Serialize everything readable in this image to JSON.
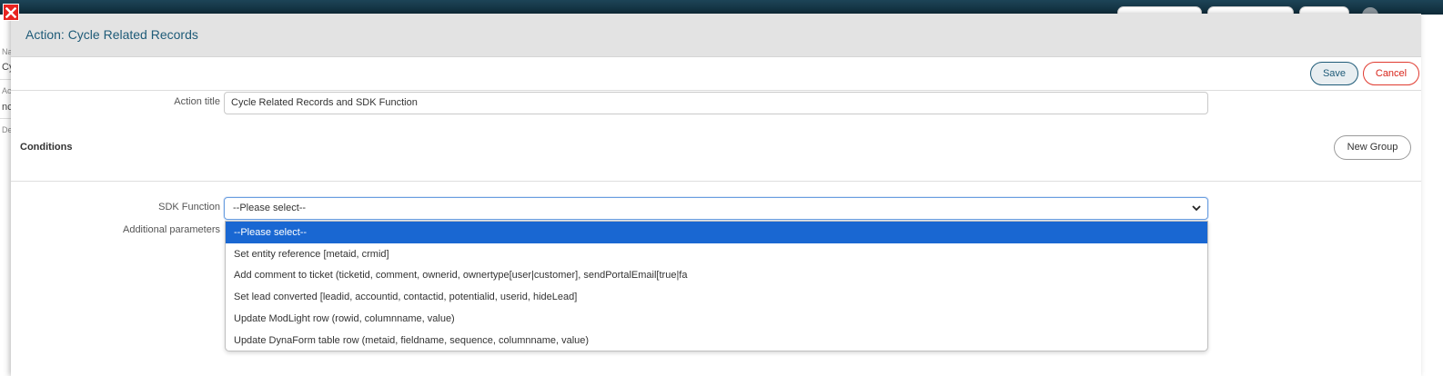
{
  "background": {
    "side_labels": [
      "Na",
      "Cy",
      "Ac",
      "nc",
      "De"
    ]
  },
  "modal": {
    "title": "Action: Cycle Related Records",
    "save_label": "Save",
    "cancel_label": "Cancel",
    "action_title_label": "Action title",
    "action_title_value": "Cycle Related Records and SDK Function",
    "conditions_label": "Conditions",
    "new_group_label": "New Group",
    "sdk_function_label": "SDK Function",
    "additional_parameters_label": "Additional parameters",
    "sdk_select_value": "--Please select--",
    "sdk_options": [
      "--Please select--",
      "Set entity reference [metaid, crmid]",
      "Add comment to ticket (ticketid, comment, ownerid, ownertype[user|customer], sendPortalEmail[true|fa",
      "Set lead converted [leadid, accountid, contactid, potentialid, userid, hideLead]",
      "Update ModLight row (rowid, columnname, value)",
      "Update DynaForm table row (metaid, fieldname, sequence, columnname, value)"
    ]
  },
  "colors": {
    "header_bg": "#1d4457",
    "title_text": "#1e5b78",
    "close_red": "#e8231f",
    "cancel_red": "#d8241a",
    "select_highlight": "#1967d2"
  }
}
